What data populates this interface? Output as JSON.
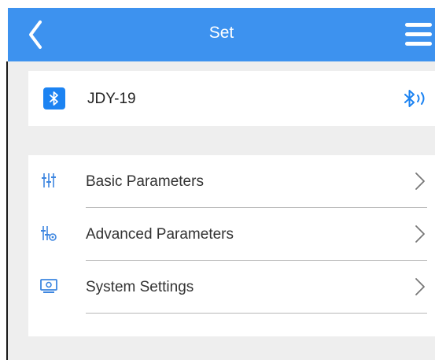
{
  "header": {
    "title": "Set",
    "back_icon": "chevron-left-icon",
    "menu_icon": "hamburger-menu-icon",
    "background_color": "#3d92ef"
  },
  "device": {
    "name": "JDY-19",
    "badge_icon": "bluetooth-icon",
    "status_icon": "bluetooth-signal-icon",
    "accent_color": "#1c83f2"
  },
  "menu": {
    "items": [
      {
        "label": "Basic Parameters",
        "icon": "sliders-icon"
      },
      {
        "label": "Advanced Parameters",
        "icon": "advanced-sliders-icon"
      },
      {
        "label": "System Settings",
        "icon": "monitor-icon"
      }
    ]
  }
}
